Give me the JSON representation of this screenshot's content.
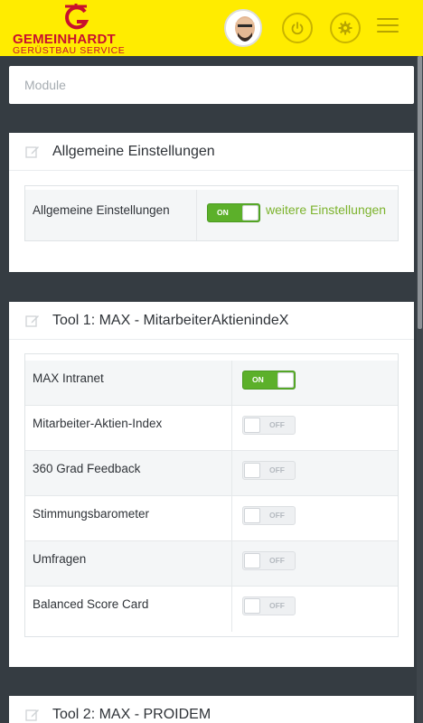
{
  "header": {
    "brand_name": "GEMEINHARDT",
    "brand_sub": "GERÜSTBAU SERVICE",
    "colors": {
      "bar": "#ffec00",
      "brand": "#c8102e"
    },
    "icons": [
      "logo-mark",
      "avatar",
      "power-icon",
      "gear-icon",
      "menu-icon"
    ]
  },
  "module_bar": {
    "label": "Module"
  },
  "panels": {
    "general": {
      "title": "Allgemeine Einstellungen",
      "row_label": "Allgemeine Einstellungen",
      "toggle": "ON",
      "link": "weitere Einstellungen"
    },
    "tool1": {
      "title": "Tool 1: MAX - MitarbeiterAktienindeX",
      "rows": [
        {
          "label": "MAX Intranet",
          "toggle": "ON"
        },
        {
          "label": "Mitarbeiter-Aktien-Index",
          "toggle": "OFF"
        },
        {
          "label": "360 Grad Feedback",
          "toggle": "OFF"
        },
        {
          "label": "Stimmungsbarometer",
          "toggle": "OFF"
        },
        {
          "label": "Umfragen",
          "toggle": "OFF"
        },
        {
          "label": "Balanced Score Card",
          "toggle": "OFF"
        }
      ]
    },
    "tool2": {
      "title": "Tool 2: MAX - PROIDEM"
    }
  },
  "colors": {
    "toggle_on": "#5cb02a",
    "link": "#7cb32d",
    "background": "#353c42"
  }
}
